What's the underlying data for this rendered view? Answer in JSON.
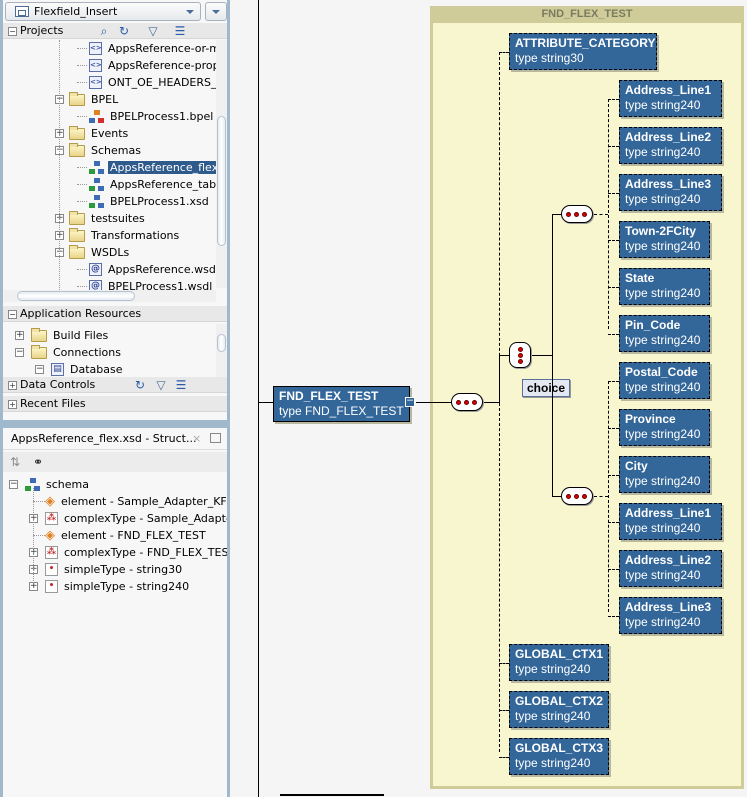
{
  "app_navigator": {
    "application": "Flexfield_Insert",
    "projects_label": "Projects",
    "projects_tree": [
      {
        "label": "AppsReference-or-ma",
        "icon": "wsdl-icon",
        "indent": 3
      },
      {
        "label": "AppsReference-prope",
        "icon": "wsdl-icon",
        "indent": 3
      },
      {
        "label": "ONT_OE_HEADERS_IF",
        "icon": "wsdl-icon",
        "indent": 3
      },
      {
        "label": "BPEL",
        "icon": "folder-icon",
        "indent": 2,
        "expander": "-"
      },
      {
        "label": "BPELProcess1.bpel",
        "icon": "bpel-process-icon",
        "indent": 3
      },
      {
        "label": "Events",
        "icon": "folder-icon",
        "indent": 2,
        "expander": "+"
      },
      {
        "label": "Schemas",
        "icon": "folder-icon",
        "indent": 2,
        "expander": "-"
      },
      {
        "label": "AppsReference_flex.x",
        "icon": "schema-icon",
        "indent": 3,
        "selected": true
      },
      {
        "label": "AppsReference_table",
        "icon": "schema-icon",
        "indent": 3
      },
      {
        "label": "BPELProcess1.xsd",
        "icon": "schema-icon",
        "indent": 3
      },
      {
        "label": "testsuites",
        "icon": "folder-icon",
        "indent": 2,
        "expander": "+"
      },
      {
        "label": "Transformations",
        "icon": "folder-icon",
        "indent": 2,
        "expander": "+"
      },
      {
        "label": "WSDLs",
        "icon": "folder-icon",
        "indent": 2,
        "expander": "-"
      },
      {
        "label": "AppsReference.wsdl",
        "icon": "wsdl-at-icon",
        "indent": 3
      },
      {
        "label": "BPELProcess1.wsdl",
        "icon": "wsdl-at-icon",
        "indent": 3
      }
    ],
    "app_resources_label": "Application Resources",
    "app_resources_tree": [
      {
        "label": "Build Files",
        "icon": "folder-icon",
        "expander": "+"
      },
      {
        "label": "Connections",
        "icon": "folder-icon",
        "expander": "-"
      },
      {
        "label": "Database",
        "icon": "database-icon",
        "expander": "-"
      }
    ],
    "data_controls_label": "Data Controls",
    "recent_files_label": "Recent Files"
  },
  "structure_panel": {
    "tab_title": "AppsReference_flex.xsd - Struct...",
    "root": "schema",
    "items": [
      {
        "label": "element - Sample_Adapter_KFF",
        "icon": "element-icon",
        "expander": ""
      },
      {
        "label": "complexType - Sample_Adapter_KFF",
        "icon": "complex-type-icon",
        "expander": "+"
      },
      {
        "label": "element - FND_FLEX_TEST",
        "icon": "element-icon",
        "expander": ""
      },
      {
        "label": "complexType - FND_FLEX_TEST",
        "icon": "complex-type-icon",
        "expander": "+"
      },
      {
        "label": "simpleType - string30",
        "icon": "simple-type-icon",
        "expander": "+"
      },
      {
        "label": "simpleType - string240",
        "icon": "simple-type-icon",
        "expander": "+"
      }
    ]
  },
  "diagram": {
    "group_title": "FND_FLEX_TEST",
    "root_element": {
      "name": "FND_FLEX_TEST",
      "type": "type FND_FLEX_TEST"
    },
    "tooltip": "choice",
    "attribute_category": {
      "name": "ATTRIBUTE_CATEGORY",
      "type": "type string30"
    },
    "choice_seq1": [
      {
        "name": "Address_Line1",
        "type": "type string240"
      },
      {
        "name": "Address_Line2",
        "type": "type string240"
      },
      {
        "name": "Address_Line3",
        "type": "type string240"
      },
      {
        "name": "Town-2FCity",
        "type": "type string240"
      },
      {
        "name": "State",
        "type": "type string240"
      },
      {
        "name": "Pin_Code",
        "type": "type string240"
      }
    ],
    "choice_seq2": [
      {
        "name": "Postal_Code",
        "type": "type string240"
      },
      {
        "name": "Province",
        "type": "type string240"
      },
      {
        "name": "City",
        "type": "type string240"
      },
      {
        "name": "Address_Line1",
        "type": "type string240"
      },
      {
        "name": "Address_Line2",
        "type": "type string240"
      },
      {
        "name": "Address_Line3",
        "type": "type string240"
      }
    ],
    "globals": [
      {
        "name": "GLOBAL_CTX1",
        "type": "type string240"
      },
      {
        "name": "GLOBAL_CTX2",
        "type": "type string240"
      },
      {
        "name": "GLOBAL_CTX3",
        "type": "type string240"
      }
    ]
  }
}
